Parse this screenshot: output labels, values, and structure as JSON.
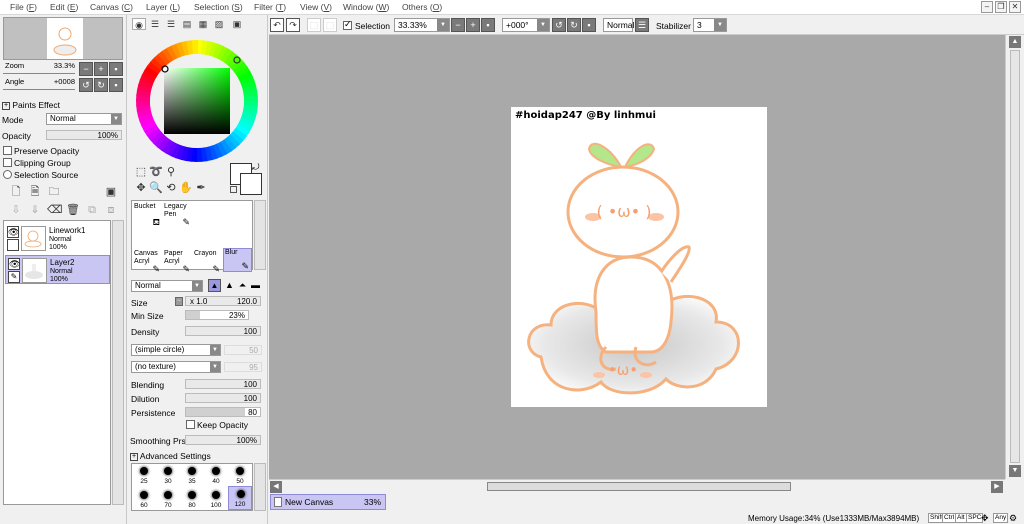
{
  "menu": {
    "items": [
      {
        "label": "File",
        "key": "F"
      },
      {
        "label": "Edit",
        "key": "E"
      },
      {
        "label": "Canvas",
        "key": "C"
      },
      {
        "label": "Layer",
        "key": "L"
      },
      {
        "label": "Selection",
        "key": "S"
      },
      {
        "label": "Filter",
        "key": "T"
      },
      {
        "label": "View",
        "key": "V"
      },
      {
        "label": "Window",
        "key": "W"
      },
      {
        "label": "Others",
        "key": "O"
      }
    ]
  },
  "navigator": {
    "zoom_label": "Zoom",
    "zoom_value": "33.3%",
    "angle_label": "Angle",
    "angle_value": "+0008"
  },
  "paint_effect": {
    "header": "Paints Effect",
    "mode_label": "Mode",
    "mode_value": "Normal",
    "opacity_label": "Opacity",
    "opacity_value": "100%",
    "opacity_fraction": 1.0,
    "preserve_opacity": "Preserve Opacity",
    "clipping_group": "Clipping Group",
    "selection_source": "Selection Source"
  },
  "layers": [
    {
      "name": "Linework1",
      "mode": "Normal",
      "opacity": "100%",
      "selected": false
    },
    {
      "name": "Layer2",
      "mode": "Normal",
      "opacity": "100%",
      "selected": true
    }
  ],
  "toolbar": {
    "selection_label": "Selection",
    "zoom": "33.33%",
    "rotation": "+000°",
    "blend_mode": "Normal",
    "stabilizer_label": "Stabilizer",
    "stabilizer_value": "3"
  },
  "brushes": {
    "row1": [
      {
        "line1": "Bucket",
        "line2": ""
      },
      {
        "line1": "Legacy",
        "line2": "Pen"
      }
    ],
    "row2": [
      {
        "line1": "Canvas",
        "line2": "Acryl"
      },
      {
        "line1": "Paper",
        "line2": "Acryl"
      },
      {
        "line1": "Crayon",
        "line2": ""
      },
      {
        "line1": "Blur",
        "line2": ""
      }
    ]
  },
  "brush_settings": {
    "mode": "Normal",
    "size_label": "Size",
    "size_mult": "x 1.0",
    "size_value": "120.0",
    "size_fraction": 1.0,
    "min_size_label": "Min Size",
    "min_size_value": "23%",
    "min_size_fraction": 0.23,
    "density_label": "Density",
    "density_value": "100",
    "shape": "(simple circle)",
    "shape_value": "50",
    "texture": "(no texture)",
    "texture_value": "95",
    "blending_label": "Blending",
    "blending_value": "100",
    "dilution_label": "Dilution",
    "dilution_value": "100",
    "persistence_label": "Persistence",
    "persistence_value": "80",
    "persistence_fraction": 0.8,
    "keep_opacity": "Keep Opacity",
    "smoothing_label": "Smoothing Prs",
    "smoothing_value": "100%",
    "advanced": "Advanced Settings"
  },
  "brush_sizes": {
    "row1": [
      "25",
      "30",
      "35",
      "40",
      "50"
    ],
    "row2": [
      "60",
      "70",
      "80",
      "100",
      "120"
    ],
    "selected": "120"
  },
  "artwork": {
    "caption": "#hoidap247 @By linhmui",
    "face_top": "( •ω• )",
    "face_bottom": "•ω•"
  },
  "canvas_tab": {
    "name": "New Canvas",
    "zoom": "33%"
  },
  "status": {
    "memory": "Memory Usage:34% (Use1333MB/Max3894MB)",
    "keys": [
      "Shift",
      "Ctrl",
      "Alt",
      "SPC",
      "Any"
    ]
  }
}
